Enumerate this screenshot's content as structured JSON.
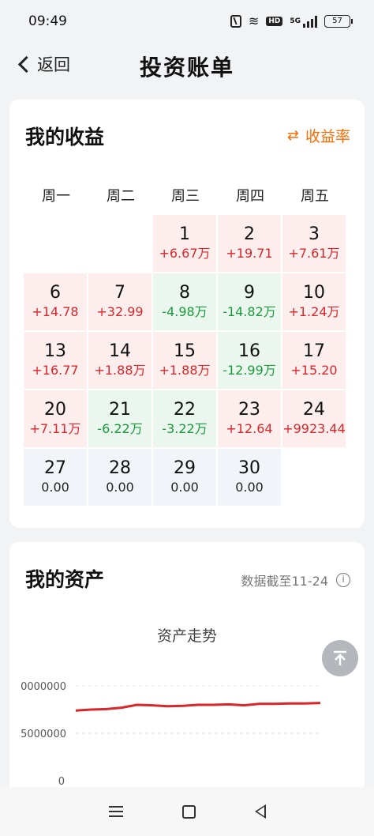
{
  "status": {
    "time": "09:49",
    "net": "5G",
    "battery": "57"
  },
  "header": {
    "back_label": "返回",
    "title": "投资账单"
  },
  "income": {
    "title": "我的收益",
    "rate_label": "收益率",
    "weekdays": [
      "周一",
      "周二",
      "周三",
      "周四",
      "周五"
    ],
    "days": [
      {
        "day": "1",
        "amount": "+6.67万",
        "trend": "up"
      },
      {
        "day": "2",
        "amount": "+19.71",
        "trend": "up"
      },
      {
        "day": "3",
        "amount": "+7.61万",
        "trend": "up"
      },
      {
        "day": "6",
        "amount": "+14.78",
        "trend": "up"
      },
      {
        "day": "7",
        "amount": "+32.99",
        "trend": "up"
      },
      {
        "day": "8",
        "amount": "-4.98万",
        "trend": "down"
      },
      {
        "day": "9",
        "amount": "-14.82万",
        "trend": "down"
      },
      {
        "day": "10",
        "amount": "+1.24万",
        "trend": "up"
      },
      {
        "day": "13",
        "amount": "+16.77",
        "trend": "up"
      },
      {
        "day": "14",
        "amount": "+1.88万",
        "trend": "up"
      },
      {
        "day": "15",
        "amount": "+1.88万",
        "trend": "up"
      },
      {
        "day": "16",
        "amount": "-12.99万",
        "trend": "down"
      },
      {
        "day": "17",
        "amount": "+15.20",
        "trend": "up"
      },
      {
        "day": "20",
        "amount": "+7.11万",
        "trend": "up"
      },
      {
        "day": "21",
        "amount": "-6.22万",
        "trend": "down"
      },
      {
        "day": "22",
        "amount": "-3.22万",
        "trend": "down"
      },
      {
        "day": "23",
        "amount": "+12.64",
        "trend": "up"
      },
      {
        "day": "24",
        "amount": "+9923.44",
        "trend": "up"
      },
      {
        "day": "27",
        "amount": "0.00",
        "trend": "flat"
      },
      {
        "day": "28",
        "amount": "0.00",
        "trend": "flat"
      },
      {
        "day": "29",
        "amount": "0.00",
        "trend": "flat"
      },
      {
        "day": "30",
        "amount": "0.00",
        "trend": "flat"
      }
    ]
  },
  "assets": {
    "title": "我的资产",
    "date_note": "数据截至11-24",
    "chart_title": "资产走势"
  },
  "chart_data": {
    "type": "line",
    "title": "资产走势",
    "ytick_labels": [
      "0000000",
      "5000000",
      "0"
    ],
    "series": [
      {
        "color": "#d9262a",
        "values": [
          7.4,
          7.5,
          7.55,
          7.7,
          8.0,
          7.95,
          7.85,
          7.9,
          8.0,
          8.0,
          8.05,
          7.95,
          8.1,
          8.1,
          8.15,
          8.15,
          8.2
        ]
      }
    ],
    "ylim": [
      0,
      11
    ],
    "grid": true
  },
  "colors": {
    "accent": "#ff6a00",
    "gain": "#d9262a",
    "loss": "#1a9a3d"
  }
}
